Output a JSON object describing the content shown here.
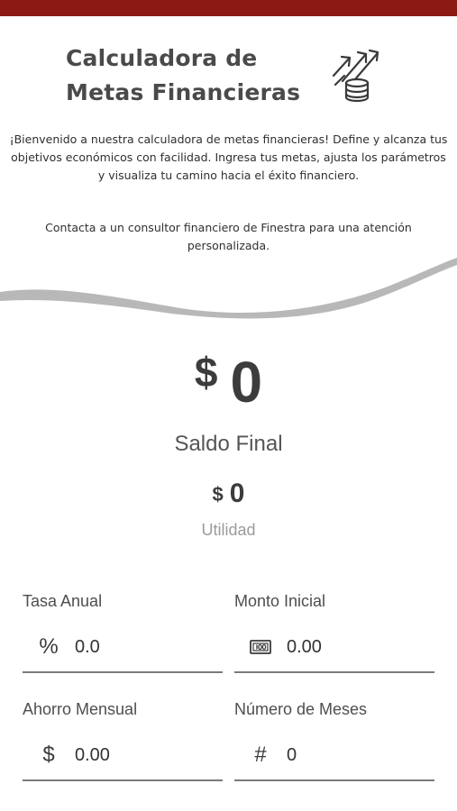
{
  "header": {
    "accent_color": "#8b1a14",
    "title_line1": "Calculadora de",
    "title_line2": "Metas Financieras",
    "logo_icon": "finance-growth-coins-icon"
  },
  "intro": {
    "text": "¡Bienvenido a nuestra calculadora de metas financieras! Define y alcanza tus objetivos económicos con facilidad. Ingresa tus metas, ajusta los parámetros y visualiza tu camino hacia el éxito financiero.",
    "contact": "Contacta a un consultor financiero de Finestra para una atención personalizada."
  },
  "results": {
    "balance_currency": "$",
    "balance_value": "0",
    "balance_label": "Saldo Final",
    "profit_currency": "$",
    "profit_value": "0",
    "profit_label": "Utilidad"
  },
  "fields": {
    "tasa": {
      "label": "Tasa Anual",
      "icon": "percent-icon",
      "glyph": "%",
      "value": "0.0"
    },
    "monto": {
      "label": "Monto Inicial",
      "icon": "cash-bill-icon",
      "glyph": "",
      "value": "0.00"
    },
    "ahorro": {
      "label": "Ahorro Mensual",
      "icon": "dollar-icon",
      "glyph": "$",
      "value": "0.00"
    },
    "meses": {
      "label": "Número de Meses",
      "icon": "hash-icon",
      "glyph": "#",
      "value": "0"
    }
  }
}
